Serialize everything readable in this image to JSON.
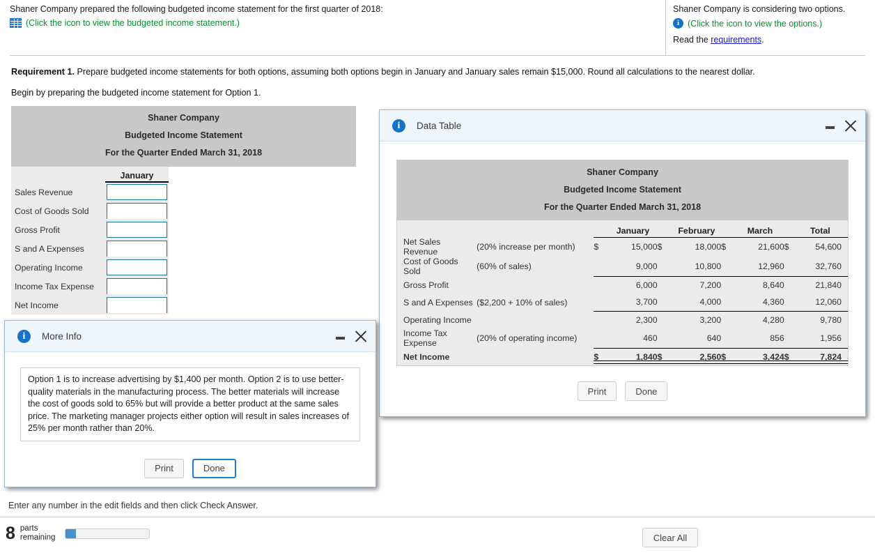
{
  "header": {
    "left": {
      "intro": "Shaner Company prepared the following budgeted income statement for the first quarter of 2018:",
      "icon": "grid-icon",
      "icon_link": "(Click the icon to view the budgeted income statement.)"
    },
    "right": {
      "intro": "Shaner Company is considering two options.",
      "icon": "info-icon",
      "icon_link": "(Click the icon to view the options.)",
      "read_prefix": "Read the ",
      "read_link": "requirements",
      "read_suffix": "."
    }
  },
  "requirement": {
    "label": "Requirement 1.",
    "text": " Prepare budgeted income statements for both options, assuming both options begin in January and January sales remain $15,000. Round all calculations to the nearest dollar.",
    "begin": "Begin by preparing the budgeted income statement for Option 1."
  },
  "worksheet": {
    "title1": "Shaner Company",
    "title2": "Budgeted Income Statement",
    "title3": "For the Quarter Ended March 31, 2018",
    "column": "January",
    "rows": [
      {
        "label": "Sales Revenue",
        "value": "",
        "rule": "none"
      },
      {
        "label": "Cost of Goods Sold",
        "value": "",
        "rule": "single"
      },
      {
        "label": "Gross Profit",
        "value": "",
        "rule": "none"
      },
      {
        "label": "S and A Expenses",
        "value": "",
        "rule": "single"
      },
      {
        "label": "Operating Income",
        "value": "",
        "rule": "none"
      },
      {
        "label": "Income Tax Expense",
        "value": "",
        "rule": "single"
      },
      {
        "label": "Net Income",
        "value": "",
        "rule": "double"
      }
    ]
  },
  "data_table_dialog": {
    "title": "Data Table",
    "icon": "info-icon",
    "minimize": "minimize-icon",
    "close": "close-icon",
    "print_label": "Print",
    "done_label": "Done",
    "table": {
      "title1": "Shaner Company",
      "title2": "Budgeted Income Statement",
      "title3": "For the Quarter Ended March 31, 2018",
      "columns": [
        "January",
        "February",
        "March",
        "Total"
      ],
      "rows": [
        {
          "label": "Net Sales Revenue",
          "note": "(20% increase per month)",
          "sym": "$",
          "values": [
            "15,000",
            "18,000",
            "21,600",
            "54,600"
          ],
          "rule": "none",
          "bold": false
        },
        {
          "label": "Cost of Goods Sold",
          "note": "(60% of sales)",
          "sym": "",
          "values": [
            "9,000",
            "10,800",
            "12,960",
            "32,760"
          ],
          "rule": "single",
          "bold": false
        },
        {
          "label": "Gross Profit",
          "note": "",
          "sym": "",
          "values": [
            "6,000",
            "7,200",
            "8,640",
            "21,840"
          ],
          "rule": "none",
          "bold": false
        },
        {
          "label": "S and A Expenses",
          "note": "($2,200 + 10% of sales)",
          "sym": "",
          "values": [
            "3,700",
            "4,000",
            "4,360",
            "12,060"
          ],
          "rule": "single",
          "bold": false
        },
        {
          "label": "Operating Income",
          "note": "",
          "sym": "",
          "values": [
            "2,300",
            "3,200",
            "4,280",
            "9,780"
          ],
          "rule": "none",
          "bold": false
        },
        {
          "label": "Income Tax Expense",
          "note": "(20% of operating income)",
          "sym": "",
          "values": [
            "460",
            "640",
            "856",
            "1,956"
          ],
          "rule": "single",
          "bold": false
        },
        {
          "label": "Net Income",
          "note": "",
          "sym": "$",
          "values": [
            "1,840",
            "2,560",
            "3,424",
            "7,824"
          ],
          "rule": "double",
          "bold": true
        }
      ]
    }
  },
  "more_info_dialog": {
    "title": "More Info",
    "icon": "info-icon",
    "minimize": "minimize-icon",
    "close": "close-icon",
    "body": "Option 1 is to increase advertising by $1,400 per month. Option 2 is to use better-quality materials in the manufacturing process. The better materials will increase the cost of goods sold to 65% but will provide a better product at the same sales price. The marketing manager projects either option will result in sales increases of 25% per month rather than 20%.",
    "print_label": "Print",
    "done_label": "Done"
  },
  "footer": {
    "hint": "Enter any number in the edit fields and then click Check Answer.",
    "parts_count": "8",
    "parts_label_line1": "parts",
    "parts_label_line2": "remaining",
    "progress_percent": 12,
    "clear_all_label": "Clear All"
  },
  "colors": {
    "accent_blue": "#1473c4",
    "green_link": "#0a8f2e",
    "link_blue": "#1818c8",
    "input_border": "#1a7b96",
    "progress_fill": "#4a90cd",
    "table_header_gray": "#c8c8c8"
  }
}
